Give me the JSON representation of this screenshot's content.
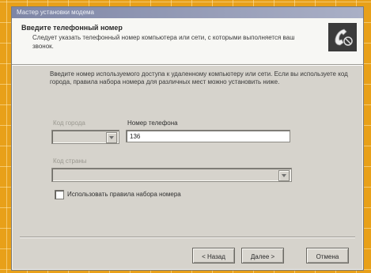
{
  "window": {
    "title": "Мастер установки модема"
  },
  "header": {
    "title": "Введите телефонный номер",
    "subtitle": "Следует указать телефонный номер компьютера или сети, с которыми выполняется ваш звонок."
  },
  "body": {
    "instructions": "Введите номер используемого доступа к удаленному компьютеру или сети. Если вы используете код города, правила набора номера для различных мест можно установить ниже."
  },
  "fields": {
    "area_code_label": "Код города",
    "area_code_value": "",
    "phone_label": "Номер телефона",
    "phone_value": "136",
    "country_label": "Код страны",
    "country_value": "",
    "use_dialing_rules_label": "Использовать правила набора номера",
    "use_dialing_rules_checked": false
  },
  "buttons": {
    "back": "< Назад",
    "next": "Далее >",
    "cancel": "Отмена"
  },
  "colors": {
    "backdrop": "#e8a018",
    "dialog_face": "#d6d3cc"
  },
  "icons": {
    "header_icon": "phone-handset-icon"
  }
}
